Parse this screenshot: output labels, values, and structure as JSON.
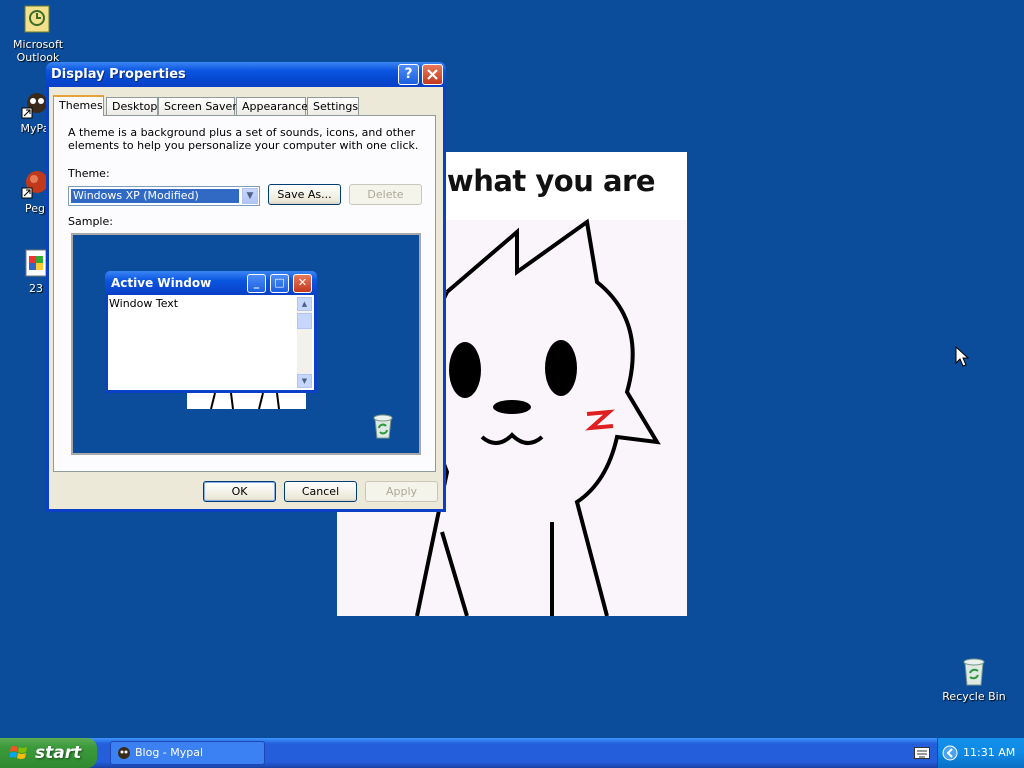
{
  "desktop": {
    "icons": [
      {
        "label": "Microsoft Outlook",
        "icon": "outlook-icon"
      },
      {
        "label": "MyPa",
        "icon": "mypal-icon"
      },
      {
        "label": "Peg",
        "icon": "pegasus-icon"
      },
      {
        "label": "23",
        "icon": "document-icon"
      },
      {
        "label": "Recycle Bin",
        "icon": "recycle-bin-icon"
      }
    ],
    "wallpaper_caption": "w what you are"
  },
  "dialog": {
    "title": "Display Properties",
    "help_label": "?",
    "close_label": "X",
    "tabs": [
      "Themes",
      "Desktop",
      "Screen Saver",
      "Appearance",
      "Settings"
    ],
    "selected_tab": "Themes",
    "description": "A theme is a background plus a set of sounds, icons, and other elements to help you personalize your computer with one click.",
    "theme_label": "Theme:",
    "theme_value": "Windows XP (Modified)",
    "save_as_label": "Save As...",
    "delete_label": "Delete",
    "sample_label": "Sample:",
    "preview": {
      "window_title": "Active Window",
      "window_text": "Window Text"
    },
    "ok_label": "OK",
    "cancel_label": "Cancel",
    "apply_label": "Apply"
  },
  "taskbar": {
    "start_label": "start",
    "task_label": "Blog - Mypal",
    "clock": "11:31 AM"
  }
}
